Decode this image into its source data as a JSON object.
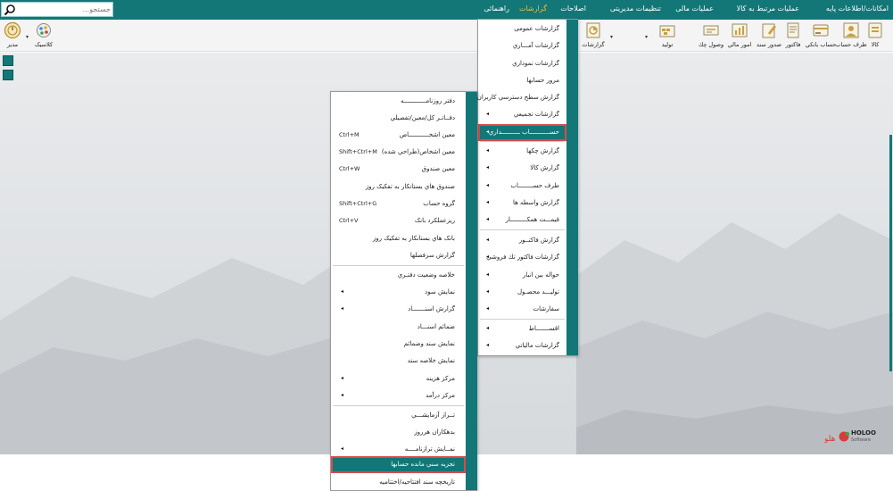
{
  "search": {
    "placeholder": "جستجو..."
  },
  "menubar": {
    "items": [
      {
        "id": "base",
        "label": "امکانات/اطلاعات پایه"
      },
      {
        "id": "goods",
        "label": "عملیات مرتبط به کالا"
      },
      {
        "id": "finance",
        "label": "عملیات مالی"
      },
      {
        "id": "admin",
        "label": "تنظیمات مدیریتی"
      },
      {
        "id": "fixes",
        "label": "اصلاحات"
      },
      {
        "id": "reports",
        "label": "گزارشات"
      },
      {
        "id": "help",
        "label": "راهنمائی"
      }
    ],
    "active": "reports",
    "active_color": "#f0c040"
  },
  "toolbar": {
    "buttons": [
      {
        "id": "kala",
        "label": "کالا",
        "icon": "box-icon"
      },
      {
        "id": "taraf",
        "label": "طرف حساب",
        "icon": "person-icon"
      },
      {
        "id": "bank",
        "label": "حساب بانکي",
        "icon": "bank-card-icon"
      },
      {
        "id": "factor",
        "label": "فاکتور",
        "icon": "invoice-icon"
      },
      {
        "id": "sanad",
        "label": "صدور سند",
        "icon": "document-icon"
      },
      {
        "id": "mali",
        "label": "امور مالي",
        "icon": "finance-icon"
      },
      {
        "id": "cheque",
        "label": "وصول چك",
        "icon": "cheque-icon"
      },
      {
        "id": "tolid",
        "label": "توليد",
        "icon": "production-icon"
      },
      {
        "id": "reports",
        "label": "گزارشات",
        "icon": "report-icon"
      }
    ],
    "classic_label": "كلاسيک",
    "manager_label": "مدير"
  },
  "menu1": {
    "items": [
      {
        "label": "گزارشات عمومی",
        "submenu": false
      },
      {
        "label": "گزارشات آمـــاري",
        "submenu": false
      },
      {
        "label": "گزارشات نموداري",
        "submenu": false
      },
      {
        "label": "مرور حسابها",
        "submenu": false
      },
      {
        "label": "گزارش سطح دسترسي كاربران",
        "submenu": false
      },
      {
        "label": "گزارشات تجميعي",
        "submenu": true
      },
      {
        "label": "حســـــــــــاب ــــــــــداري",
        "submenu": true,
        "selected": true
      },
      {
        "label": "گزارش چكها",
        "submenu": true
      },
      {
        "label": "گزارش كالا",
        "submenu": true
      },
      {
        "label": "طرف حســــــــاب",
        "submenu": true
      },
      {
        "label": "گزارش واسطه ها",
        "submenu": true
      },
      {
        "label": "قیمـــت همکـــــــــار",
        "submenu": true
      },
      {
        "label": "گزارش فاكتــور",
        "submenu": true
      },
      {
        "label": "گزارشات فاكتور تك فروشي",
        "submenu": true
      },
      {
        "label": "حواله بين انبار",
        "submenu": true
      },
      {
        "label": "توليـــد محصـول",
        "submenu": true
      },
      {
        "label": "سفارشات",
        "submenu": true
      },
      {
        "label": "اقســـــــاط",
        "submenu": true
      },
      {
        "label": "گزارشات مالياتي",
        "submenu": true
      }
    ]
  },
  "menu2": {
    "items": [
      {
        "label": "دفتر روزنامــــــــــــه",
        "submenu": false,
        "shortcut": ""
      },
      {
        "label": "دفــاتـر كل/معين/تفصيلي",
        "submenu": false,
        "shortcut": ""
      },
      {
        "label": "معين اشخـــــــــــاص",
        "submenu": false,
        "shortcut": "Ctrl+M"
      },
      {
        "label": "معين اشخاص(طراحي شده)",
        "submenu": false,
        "shortcut": "Shift+Ctrl+M"
      },
      {
        "label": "معين صندوق",
        "submenu": false,
        "shortcut": "Ctrl+W"
      },
      {
        "label": "صندوق هاي بستانكار به تفكيک روز",
        "submenu": false,
        "shortcut": ""
      },
      {
        "label": "گروه حساب",
        "submenu": false,
        "shortcut": "Shift+Ctrl+G"
      },
      {
        "label": "ريزعملكرد بانک",
        "submenu": false,
        "shortcut": "Ctrl+V"
      },
      {
        "label": "بانک هاي بستانكار به تفكيک روز",
        "submenu": false,
        "shortcut": ""
      },
      {
        "label": "گزارش سرفصلها",
        "submenu": false,
        "shortcut": ""
      },
      {
        "label": "خلاصه وضعيت دفتـري",
        "submenu": false,
        "shortcut": ""
      },
      {
        "label": "نمايش سود",
        "submenu": true,
        "shortcut": ""
      },
      {
        "label": "گزارش   اسنـــــــاد",
        "submenu": true,
        "shortcut": ""
      },
      {
        "label": "ضمائم اسنـــاد",
        "submenu": false,
        "shortcut": ""
      },
      {
        "label": "نمايش سند وضمائم",
        "submenu": false,
        "shortcut": ""
      },
      {
        "label": "نمايش خلاصه سند",
        "submenu": false,
        "shortcut": ""
      },
      {
        "label": "مركز هزينه",
        "submenu": true,
        "shortcut": ""
      },
      {
        "label": "مركز درآمد",
        "submenu": true,
        "shortcut": ""
      },
      {
        "label": "تــراز آزمايشـــي",
        "submenu": false,
        "shortcut": ""
      },
      {
        "label": "بدهكاران هرروز",
        "submenu": false,
        "shortcut": ""
      },
      {
        "label": "نمــايش ترازنامــــه",
        "submenu": true,
        "shortcut": ""
      },
      {
        "label": "تجزيه سني مانده حسابها",
        "submenu": false,
        "shortcut": "",
        "selected": true
      },
      {
        "label": "تاريخچه سند افتتاحيه/اختتاميه",
        "submenu": false,
        "shortcut": ""
      }
    ]
  },
  "logo": {
    "brand_en": "HOLOO",
    "sub_en": "Software",
    "brand_fa": "هلو"
  },
  "colors": {
    "accent": "#137777",
    "highlight": "#d94a4a"
  }
}
